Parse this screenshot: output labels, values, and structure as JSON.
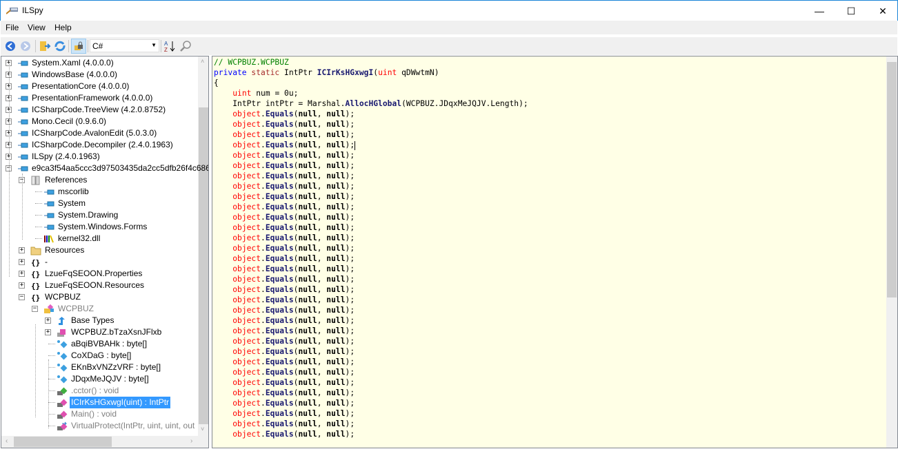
{
  "window": {
    "title": "ILSpy",
    "minimize": "—",
    "maximize": "☐",
    "close": "✕"
  },
  "menu": [
    "File",
    "View",
    "Help"
  ],
  "toolbar": {
    "language": "C#"
  },
  "tree": [
    {
      "label": "System.Xaml (4.0.0.0)",
      "depth": 0,
      "exp": "+",
      "icon": "assembly"
    },
    {
      "label": "WindowsBase (4.0.0.0)",
      "depth": 0,
      "exp": "+",
      "icon": "assembly"
    },
    {
      "label": "PresentationCore (4.0.0.0)",
      "depth": 0,
      "exp": "+",
      "icon": "assembly"
    },
    {
      "label": "PresentationFramework (4.0.0.0)",
      "depth": 0,
      "exp": "+",
      "icon": "assembly"
    },
    {
      "label": "ICSharpCode.TreeView (4.2.0.8752)",
      "depth": 0,
      "exp": "+",
      "icon": "assembly"
    },
    {
      "label": "Mono.Cecil (0.9.6.0)",
      "depth": 0,
      "exp": "+",
      "icon": "assembly"
    },
    {
      "label": "ICSharpCode.AvalonEdit (5.0.3.0)",
      "depth": 0,
      "exp": "+",
      "icon": "assembly"
    },
    {
      "label": "ICSharpCode.Decompiler (2.4.0.1963)",
      "depth": 0,
      "exp": "+",
      "icon": "assembly"
    },
    {
      "label": "ILSpy (2.4.0.1963)",
      "depth": 0,
      "exp": "+",
      "icon": "assembly"
    },
    {
      "label": "e9ca3f54aa5ccc3d97503435da2cc5dfb26f4c686",
      "depth": 0,
      "exp": "-",
      "icon": "assembly"
    },
    {
      "label": "References",
      "depth": 1,
      "exp": "-",
      "icon": "references"
    },
    {
      "label": "mscorlib",
      "depth": 2,
      "exp": "",
      "icon": "assembly"
    },
    {
      "label": "System",
      "depth": 2,
      "exp": "",
      "icon": "assembly"
    },
    {
      "label": "System.Drawing",
      "depth": 2,
      "exp": "",
      "icon": "assembly"
    },
    {
      "label": "System.Windows.Forms",
      "depth": 2,
      "exp": "",
      "icon": "assembly"
    },
    {
      "label": "kernel32.dll",
      "depth": 2,
      "exp": "",
      "icon": "library"
    },
    {
      "label": "Resources",
      "depth": 1,
      "exp": "+",
      "icon": "folder"
    },
    {
      "label": "-",
      "depth": 1,
      "exp": "+",
      "icon": "namespace"
    },
    {
      "label": "LzueFqSEOON.Properties",
      "depth": 1,
      "exp": "+",
      "icon": "namespace"
    },
    {
      "label": "LzueFqSEOON.Resources",
      "depth": 1,
      "exp": "+",
      "icon": "namespace"
    },
    {
      "label": "WCPBUZ",
      "depth": 1,
      "exp": "-",
      "icon": "namespace"
    },
    {
      "label": "WCPBUZ",
      "depth": 2,
      "exp": "-",
      "icon": "class",
      "gray": true
    },
    {
      "label": "Base Types",
      "depth": 3,
      "exp": "+",
      "icon": "base-types"
    },
    {
      "label": "WCPBUZ.bTzaXsnJFlxb",
      "depth": 3,
      "exp": "+",
      "icon": "nested-class"
    },
    {
      "label": "aBqiBVBAHk : byte[]",
      "depth": 3,
      "exp": "",
      "icon": "field"
    },
    {
      "label": "CoXDaG : byte[]",
      "depth": 3,
      "exp": "",
      "icon": "field"
    },
    {
      "label": "EKnBxVNZzVRF : byte[]",
      "depth": 3,
      "exp": "",
      "icon": "field"
    },
    {
      "label": "JDqxMeJQJV : byte[]",
      "depth": 3,
      "exp": "",
      "icon": "field"
    },
    {
      "label": ".cctor() : void",
      "depth": 3,
      "exp": "",
      "icon": "static-ctor",
      "gray": true
    },
    {
      "label": "ICIrKsHGxwgI(uint) : IntPtr",
      "depth": 3,
      "exp": "",
      "icon": "method",
      "selected": true
    },
    {
      "label": "Main() : void",
      "depth": 3,
      "exp": "",
      "icon": "method",
      "gray": true
    },
    {
      "label": "VirtualProtect(IntPtr, uint, uint, out",
      "depth": 3,
      "exp": "",
      "icon": "extern-method",
      "gray": true
    }
  ],
  "code": {
    "comment": "// WCPBUZ.WCPBUZ",
    "sig": {
      "k1": "private",
      "k2": "static",
      "ret": " IntPtr ",
      "name": "ICIrKsHGxwgI",
      "open": "(",
      "ptype": "uint",
      "pname": " qDWwtmN)"
    },
    "open_brace": "{",
    "l1": {
      "indent": "    ",
      "type": "uint",
      "rest": " num = 0u;"
    },
    "l2": {
      "indent": "    ",
      "a": "IntPtr intPtr = Marshal.",
      "fn": "AllocHGlobal",
      "b": "(WCPBUZ.JDqxMeJQJV.Length);"
    },
    "equals": {
      "indent": "    ",
      "obj": "object",
      "dot": ".",
      "fn": "Equals",
      "p1": "(",
      "n1": "null",
      ", ": ", ",
      "n2": "null",
      "end": ");"
    },
    "equals_count": 32,
    "caret_line": 3
  },
  "colors": {
    "accent": "#1883d7",
    "selection": "#3399ff",
    "code_bg": "#ffffe6"
  }
}
